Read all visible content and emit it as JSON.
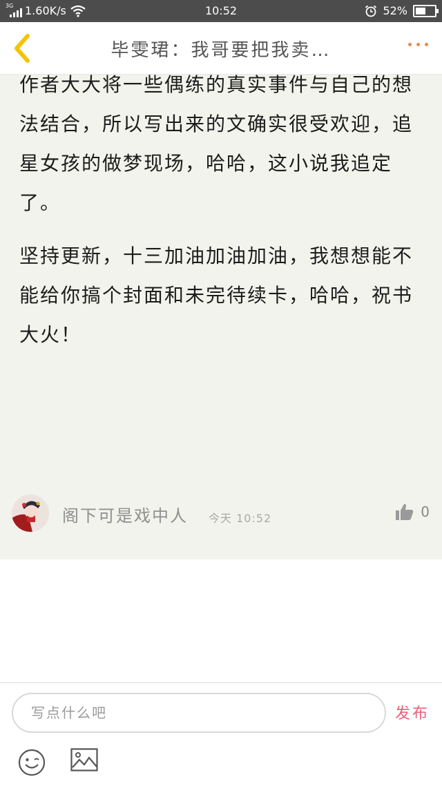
{
  "status_bar": {
    "network": "3G",
    "speed": "1.60K/s",
    "time": "10:52",
    "battery": "52%",
    "battery_level": 0.52
  },
  "header": {
    "title": "毕雯珺：我哥要把我卖…",
    "back_icon": "chevron-left-icon",
    "more_icon": "more-dots-icon",
    "accent_color": "#f5c400",
    "more_color": "#f0874d"
  },
  "content": {
    "paragraphs": [
      "作者大大将一些偶练的真实事件与自己的想法结合，所以写出来的文确实很受欢迎，追星女孩的做梦现场，哈哈，这小说我追定了。",
      "坚持更新，十三加油加油加油，我想想能不能给你搞个封面和未完待续卡，哈哈，祝书大火！"
    ],
    "background_color": "#f1f3ec"
  },
  "comment": {
    "username": "阁下可是戏中人",
    "time": "今天 10:52",
    "likes": "0"
  },
  "input_bar": {
    "placeholder": "写点什么吧",
    "value": "",
    "publish_label": "发布",
    "publish_color": "#ec5f7c"
  }
}
